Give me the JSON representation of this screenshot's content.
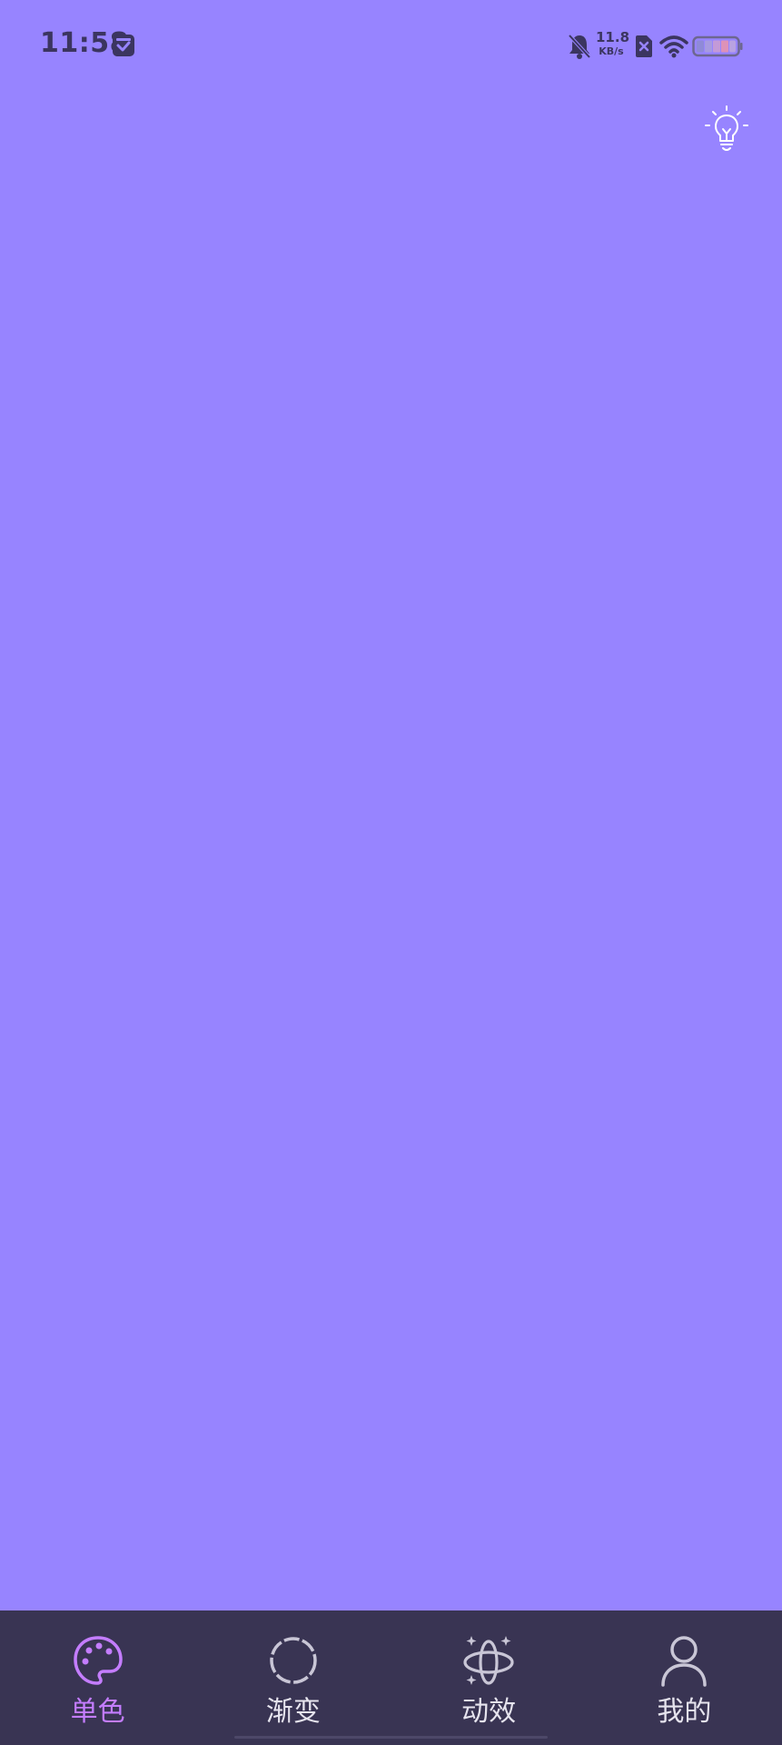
{
  "status_bar": {
    "time": "11:58",
    "net_speed_value": "11.8",
    "net_speed_unit": "KB/s",
    "icons": [
      "app-notification-icon",
      "mute-bell-icon",
      "sim-error-icon",
      "wifi-icon",
      "battery-icon"
    ]
  },
  "top_action": {
    "icon": "lightbulb-icon"
  },
  "background_color": "#9784ff",
  "nav": {
    "active_color": "#c47dff",
    "items": [
      {
        "label": "单色",
        "icon": "palette-icon",
        "active": true
      },
      {
        "label": "渐变",
        "icon": "dashed-circle-icon",
        "active": false
      },
      {
        "label": "动效",
        "icon": "orbit-sparkle-icon",
        "active": false
      },
      {
        "label": "我的",
        "icon": "user-icon",
        "active": false
      }
    ]
  }
}
